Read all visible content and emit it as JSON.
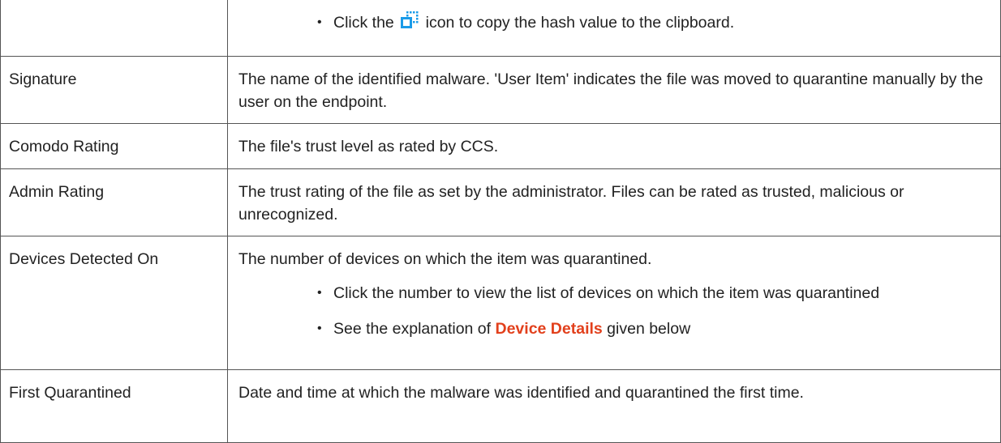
{
  "rows": [
    {
      "label": "",
      "bullets": [
        {
          "before": "Click the",
          "icon": "copy-icon",
          "after": "icon to copy the hash value to the clipboard."
        }
      ]
    },
    {
      "label": "Signature",
      "text": "The name of the identified malware. 'User Item' indicates the file was moved to quarantine manually by the user on the endpoint."
    },
    {
      "label": "Comodo Rating",
      "text": "The file's trust level as rated by CCS."
    },
    {
      "label": "Admin Rating",
      "text": "The trust rating of the file as set by the administrator. Files can be rated as trusted, malicious or unrecognized."
    },
    {
      "label": "Devices Detected On",
      "text": "The number of devices on which the item was quarantined.",
      "bullets": [
        {
          "text": "Click the number to view the list of devices on which the item was quarantined"
        },
        {
          "before": "See the explanation of",
          "link": "Device Details",
          "after": "given below"
        }
      ]
    },
    {
      "label": "First Quarantined",
      "text": "Date and time at which the malware was identified and quarantined the first time."
    }
  ],
  "bullet_char": "•",
  "colors": {
    "border": "#555555",
    "text": "#222222",
    "link": "#e2401c",
    "icon": "#1a9be8"
  }
}
